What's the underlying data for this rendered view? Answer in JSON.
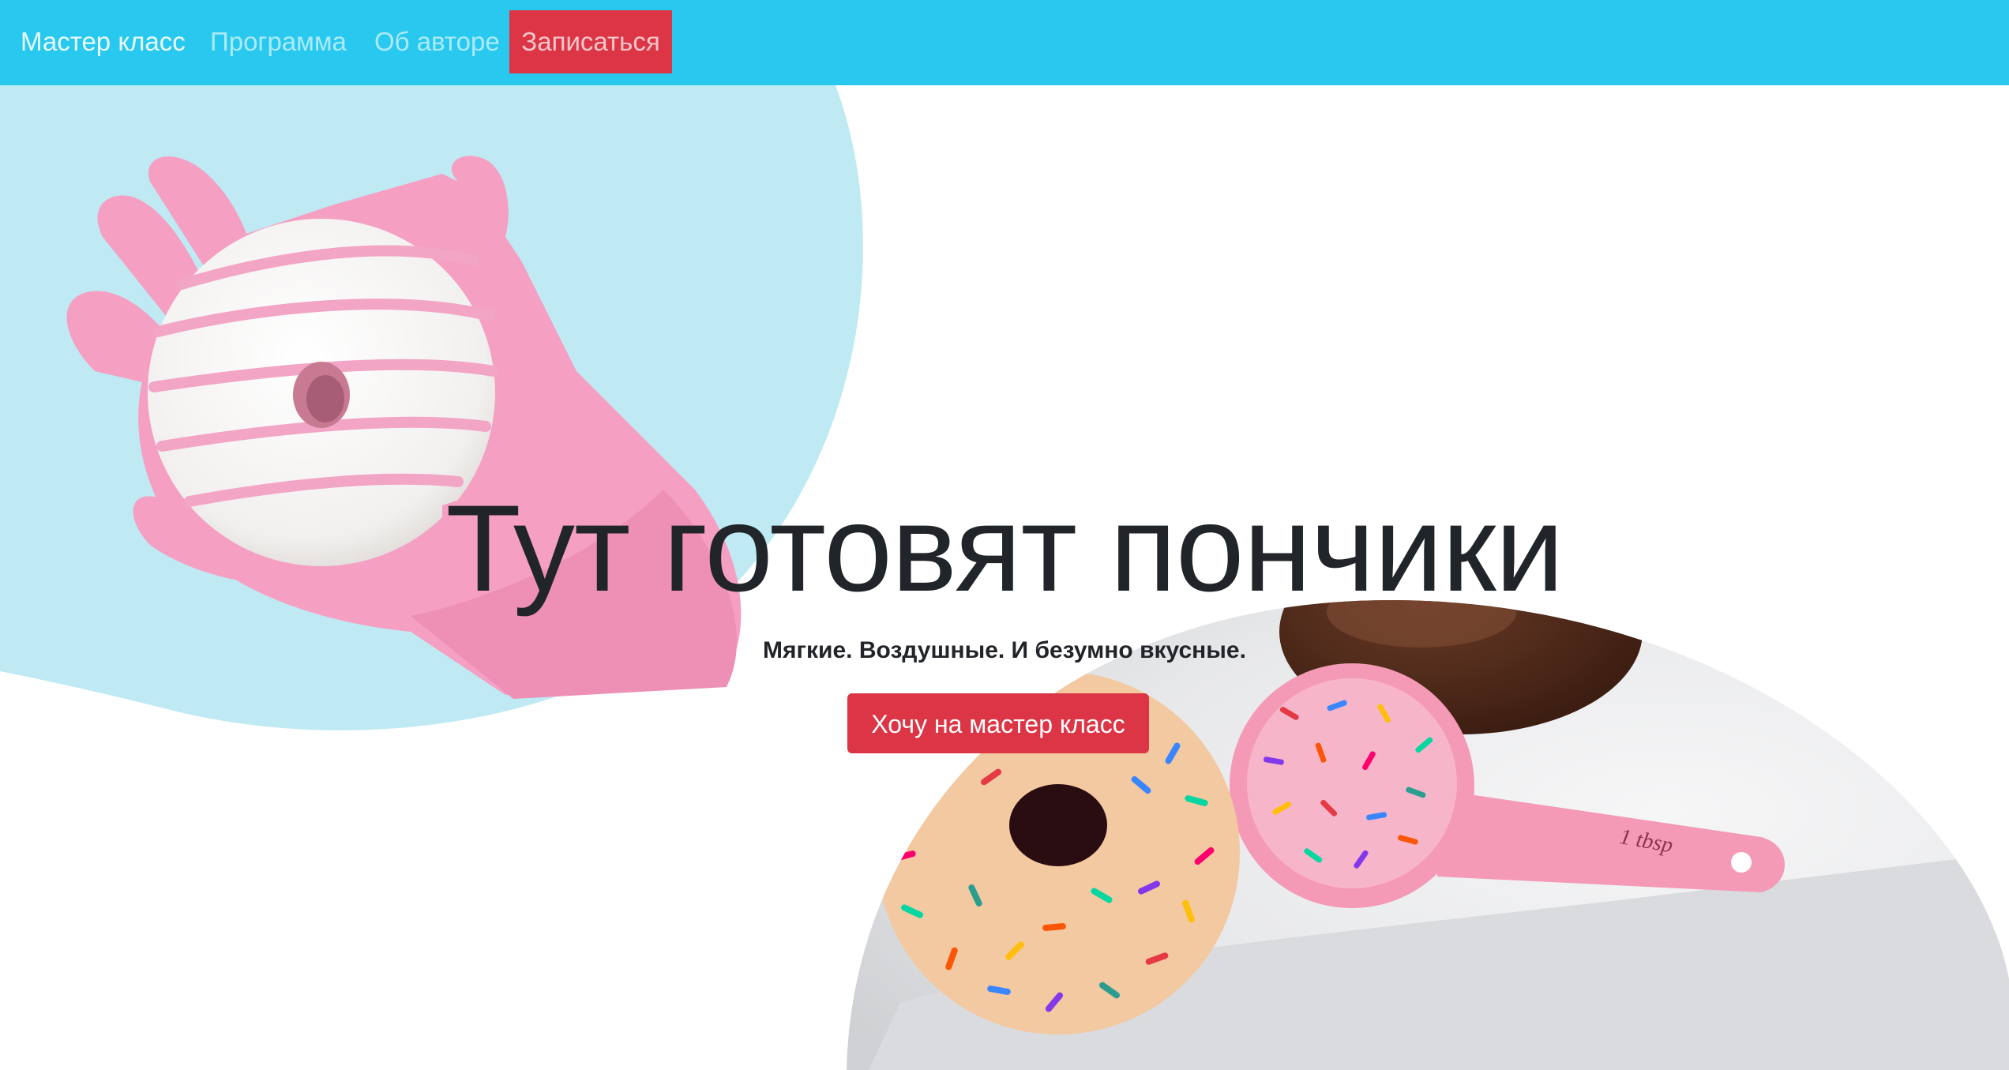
{
  "nav": {
    "items": [
      {
        "label": "Мастер класс"
      },
      {
        "label": "Программа"
      },
      {
        "label": "Об авторе"
      }
    ],
    "cta_label": "Записаться"
  },
  "hero": {
    "title": "Тут готовят пончики",
    "subtitle": "Мягкие. Воздушные. И безумно вкусные.",
    "button_label": "Хочу на мастер класс",
    "spoon_label": "1 tbsp"
  },
  "colors": {
    "navbar": "#29c9ef",
    "accent": "#dc3545",
    "blob": "#bfeaf4",
    "glove": "#f59fc2",
    "text": "#212529"
  },
  "images": [
    {
      "name": "glove-donut-image",
      "icon": "donut-in-pink-glove"
    },
    {
      "name": "sprinkles-donut-image",
      "icon": "sprinkle-donut-with-spoon"
    }
  ]
}
